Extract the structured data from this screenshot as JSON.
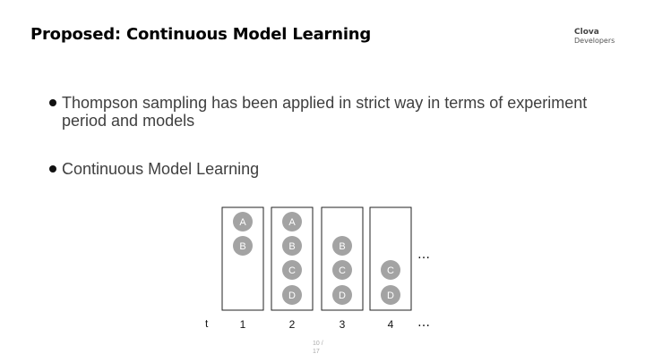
{
  "header": {
    "title": "Proposed: Continuous Model Learning",
    "brand_name": "Clova",
    "brand_sub": "Developers"
  },
  "bullets": [
    "Thompson sampling has been applied in strict way in terms of experiment period and models",
    "Continuous Model Learning"
  ],
  "diagram": {
    "axis_label": "t",
    "ellipsis": "…",
    "colors": {
      "model_fill": "#a3a3a3",
      "box_stroke": "#222222"
    },
    "steps": [
      {
        "t": "1",
        "models": [
          "A",
          "B"
        ]
      },
      {
        "t": "2",
        "models": [
          "A",
          "B",
          "C",
          "D"
        ]
      },
      {
        "t": "3",
        "models": [
          "B",
          "C",
          "D"
        ]
      },
      {
        "t": "4",
        "models": [
          "C",
          "D"
        ]
      }
    ]
  },
  "footer": {
    "page_current": "10 /",
    "page_total": "17"
  }
}
